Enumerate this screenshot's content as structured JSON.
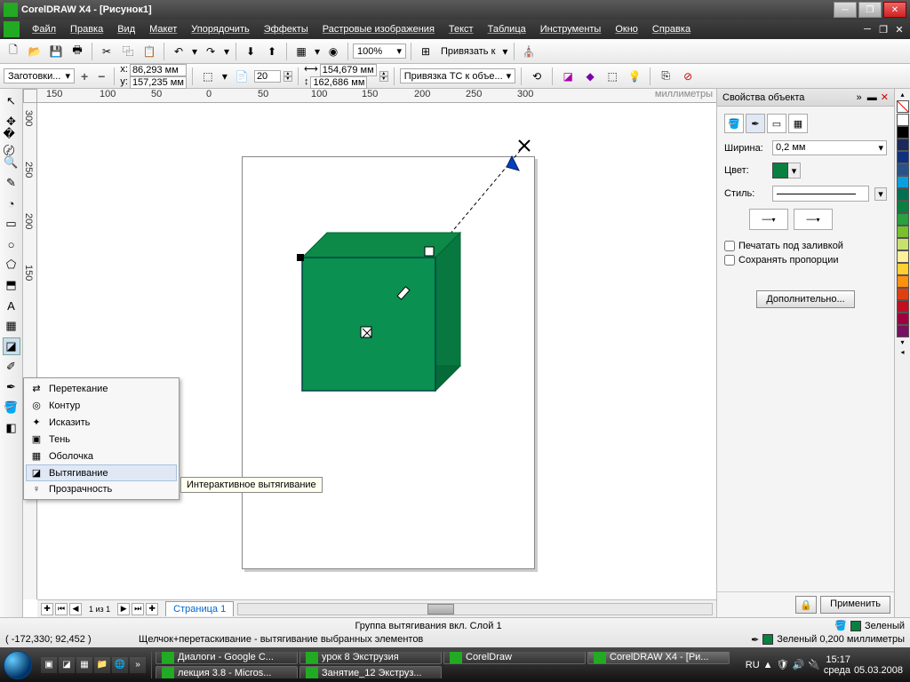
{
  "title": "CorelDRAW X4 - [Рисунок1]",
  "menu": [
    "Файл",
    "Правка",
    "Вид",
    "Макет",
    "Упорядочить",
    "Эффекты",
    "Растровые изображения",
    "Текст",
    "Таблица",
    "Инструменты",
    "Окно",
    "Справка"
  ],
  "toolbar1": {
    "zoom": "100%",
    "snap_label": "Привязать к"
  },
  "props": {
    "preset": "Заготовки...",
    "x_label": "x:",
    "x_val": "86,293 мм",
    "y_label": "y:",
    "y_val": "157,235 мм",
    "w_val": "154,679 мм",
    "h_val": "162,686 мм",
    "copies": "20",
    "bind": "Привязка ТС к объе..."
  },
  "ruler": {
    "h": [
      "150",
      "100",
      "50",
      "0",
      "50",
      "100",
      "150",
      "200",
      "250",
      "300"
    ],
    "h_unit": "миллиметры",
    "v": [
      "300",
      "250",
      "200",
      "150"
    ]
  },
  "flyout": {
    "items": [
      {
        "icon": "⇄",
        "label": "Перетекание"
      },
      {
        "icon": "◎",
        "label": "Контур"
      },
      {
        "icon": "✦",
        "label": "Исказить"
      },
      {
        "icon": "▣",
        "label": "Тень"
      },
      {
        "icon": "▦",
        "label": "Оболочка"
      },
      {
        "icon": "◪",
        "label": "Вытягивание"
      },
      {
        "icon": "♀",
        "label": "Прозрачность"
      }
    ],
    "active_index": 5,
    "tooltip": "Интерактивное вытягивание"
  },
  "docker": {
    "title": "Свойства объекта",
    "width_label": "Ширина:",
    "width_val": "0,2 мм",
    "color_label": "Цвет:",
    "style_label": "Стиль:",
    "check1": "Печатать под заливкой",
    "check2": "Сохранять пропорции",
    "advanced": "Дополнительно...",
    "apply": "Применить"
  },
  "palette_colors": [
    "#ffffff",
    "#000000",
    "#1a2a5a",
    "#103080",
    "#2a528a",
    "#0aa0e0",
    "#007050",
    "#0a8040",
    "#2aa040",
    "#78c030",
    "#c8e070",
    "#fff09a",
    "#ffd030",
    "#ff9010",
    "#e04010",
    "#c01020",
    "#a00040",
    "#7a1060"
  ],
  "pagetabs": {
    "count": "1 из 1",
    "tab": "Страница 1"
  },
  "status": {
    "coords": "( -172,330; 92,452 )",
    "hint": "Щелчок+перетаскивание - вытягивание выбранных элементов",
    "group": "Группа вытягивания вкл. Слой 1",
    "fill_name": "Зеленый",
    "outline_name": "Зеленый 0,200 миллиметры"
  },
  "taskbar": {
    "tasks": [
      "Диалоги - Google C...",
      "урок 8  Экструзия",
      "CorelDraw",
      "CorelDRAW X4 - [Ри...",
      "лекция 3.8 - Micros...",
      "Занятие_12 Экструз..."
    ],
    "lang": "RU",
    "time": "15:17",
    "date": "05.03.2008",
    "day": "среда"
  }
}
